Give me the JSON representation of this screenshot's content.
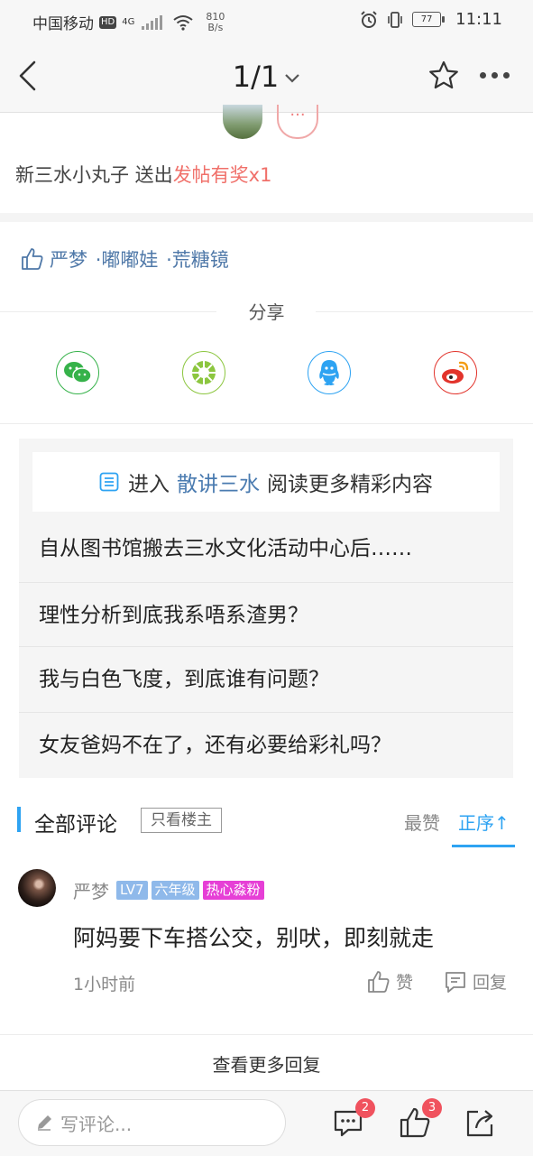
{
  "status_bar": {
    "carrier": "中国移动",
    "hd": "HD",
    "net": "4G",
    "speed_value": "810",
    "speed_unit": "B/s",
    "battery": "77",
    "time": "11:11"
  },
  "nav": {
    "page_indicator": "1/1"
  },
  "reward": {
    "user": "新三水小丸子",
    "action": " 送出",
    "item": "发帖有奖x1",
    "more": "···"
  },
  "likes": {
    "names": [
      "严梦",
      "·嘟嘟娃",
      "·荒糖镜"
    ]
  },
  "share": {
    "title": "分享",
    "targets": [
      "wechat-icon",
      "moments-icon",
      "qq-icon",
      "weibo-icon"
    ]
  },
  "related": {
    "prefix": "进入",
    "forum": "散讲三水",
    "suffix": "阅读更多精彩内容",
    "items": [
      "自从图书馆搬去三水文化活动中心后……",
      "理性分析到底我系唔系渣男？",
      "我与白色飞度，到底谁有问题？",
      "女友爸妈不在了，还有必要给彩礼吗？"
    ]
  },
  "comments": {
    "title": "全部评论",
    "owner_only": "只看楼主",
    "sort_best": "最赞",
    "sort_order": "正序↑",
    "items": [
      {
        "user": "严梦",
        "tags": [
          {
            "text": "LV7",
            "color": "#8fb9ea"
          },
          {
            "text": "六年级",
            "color": "#8fb9ea"
          },
          {
            "text": "热心淼粉",
            "color": "#e63fd6"
          }
        ],
        "text": "阿妈要下车搭公交，别吠，即刻就走",
        "time": "1小时前",
        "like_label": "赞",
        "reply_label": "回复"
      }
    ],
    "more_replies": "查看更多回复"
  },
  "bottom": {
    "placeholder": "写评论...",
    "comment_count": "2",
    "like_count": "3"
  },
  "colors": {
    "accent": "#2ea3f2",
    "highlight": "#f0706a",
    "link": "#4a7bb0"
  }
}
